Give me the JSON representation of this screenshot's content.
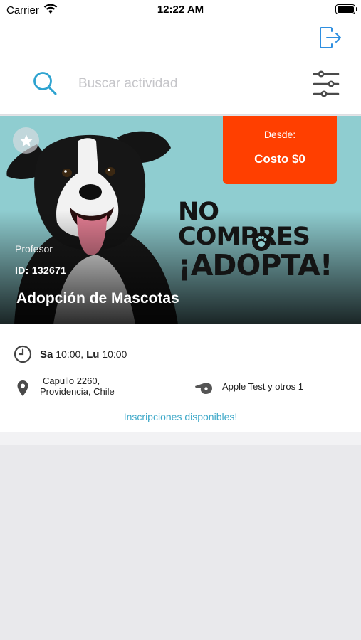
{
  "status_bar": {
    "carrier": "Carrier",
    "time": "12:22 AM"
  },
  "search": {
    "placeholder": "Buscar actividad",
    "value": ""
  },
  "activity": {
    "price_label": "Desde:",
    "price_value": "Costo $0",
    "promo_line1": "NO COMPRES",
    "promo_line2": "¡ADOPTA!",
    "teacher_label": "Profesor",
    "id_text": "ID: 132671",
    "title": "Adopción de Mascotas",
    "schedule": [
      {
        "day": "Sa",
        "time": "10:00"
      },
      {
        "day": "Lu",
        "time": "10:00"
      }
    ],
    "address_line1": "Capullo 2260,",
    "address_line2": "Providencia, Chile",
    "teachers": "Apple Test y otros 1",
    "availability": "Inscripciones disponibles!"
  },
  "colors": {
    "accent": "#3fa9c9",
    "price_badge": "#ff3f00",
    "image_background": "#8fcdd0"
  },
  "icons": [
    "wifi-icon",
    "battery-icon",
    "logout-icon",
    "search-icon",
    "filter-icon",
    "star-icon",
    "clock-icon",
    "location-pin-icon",
    "whistle-icon",
    "paw-icon"
  ]
}
